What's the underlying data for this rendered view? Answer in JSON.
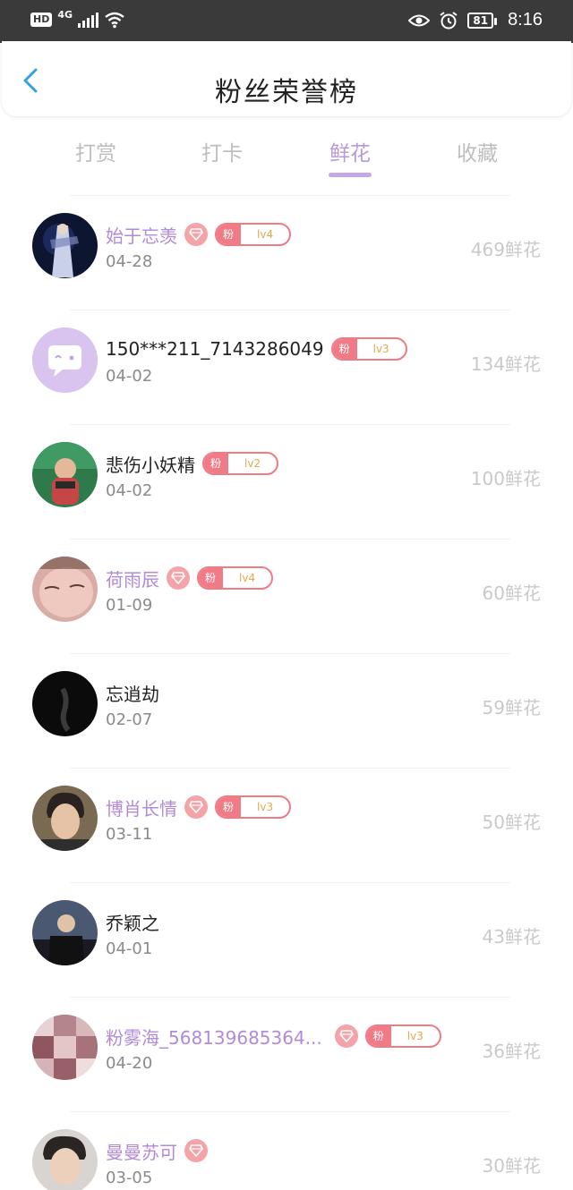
{
  "status_bar": {
    "hd": "HD",
    "network": "4G",
    "battery": "81",
    "time": "8:16"
  },
  "header": {
    "title": "粉丝荣誉榜"
  },
  "tabs": [
    {
      "label": "打赏"
    },
    {
      "label": "打卡"
    },
    {
      "label": "鲜花"
    },
    {
      "label": "收藏"
    }
  ],
  "active_tab": "鲜花",
  "fan_badge_label": "粉",
  "colors": {
    "accent": "#b799d8",
    "vip_name": "#b28ad8",
    "badge": "#f07a86"
  },
  "list": [
    {
      "name": "始于忘羡",
      "date": "04-28",
      "amount": "469鲜花",
      "vip": true,
      "level": "lv4",
      "avatar": "photo-dark-blue"
    },
    {
      "name": "150***211_7143286049",
      "date": "04-02",
      "amount": "134鲜花",
      "vip": false,
      "level": "lv3",
      "avatar": "chat-bubble-icon"
    },
    {
      "name": "悲伤小妖精",
      "date": "04-02",
      "amount": "100鲜花",
      "vip": false,
      "level": "lv2",
      "avatar": "photo-green"
    },
    {
      "name": "荷雨辰",
      "date": "01-09",
      "amount": "60鲜花",
      "vip": true,
      "level": "lv4",
      "avatar": "photo-pink"
    },
    {
      "name": "忘逍劫",
      "date": "02-07",
      "amount": "59鲜花",
      "vip": false,
      "level": "",
      "avatar": "photo-black"
    },
    {
      "name": "博肖长情",
      "date": "03-11",
      "amount": "50鲜花",
      "vip": true,
      "level": "lv3",
      "avatar": "photo-portrait"
    },
    {
      "name": "乔颖之",
      "date": "04-01",
      "amount": "43鲜花",
      "vip": false,
      "level": "",
      "avatar": "photo-stage"
    },
    {
      "name": "粉雾海_568139685364...",
      "date": "04-20",
      "amount": "36鲜花",
      "vip": true,
      "level": "lv3",
      "avatar": "photo-mosaic"
    },
    {
      "name": "曼曼苏可",
      "date": "03-05",
      "amount": "30鲜花",
      "vip": true,
      "level": "",
      "avatar": "photo-face"
    }
  ]
}
